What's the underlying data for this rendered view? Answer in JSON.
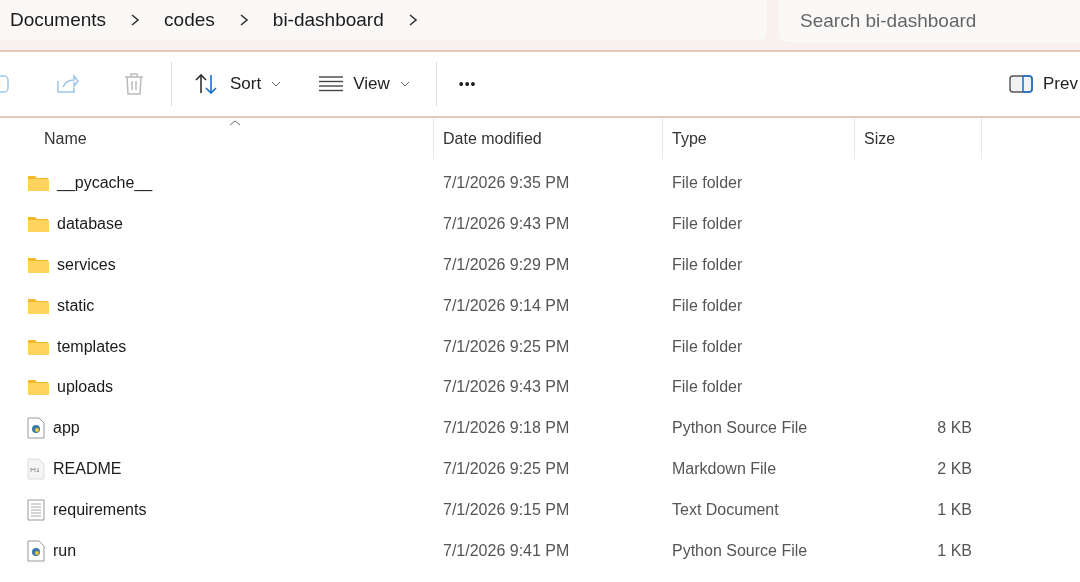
{
  "breadcrumb": [
    "Documents",
    "codes",
    "bi-dashboard"
  ],
  "search": {
    "placeholder": "Search bi-dashboard"
  },
  "toolbar": {
    "sort": "Sort",
    "view": "View",
    "more": "•••",
    "preview": "Prev"
  },
  "columns": [
    {
      "label": "Name",
      "sorted": true
    },
    {
      "label": "Date modified",
      "sorted": false
    },
    {
      "label": "Type",
      "sorted": false
    },
    {
      "label": "Size",
      "sorted": false
    }
  ],
  "rows": [
    {
      "kind": "folder",
      "name": "__pycache__",
      "date": "7/1/2026 9:35 PM",
      "type": "File folder"
    },
    {
      "kind": "folder",
      "name": "database",
      "date": "7/1/2026 9:43 PM",
      "type": "File folder"
    },
    {
      "kind": "folder",
      "name": "services",
      "date": "7/1/2026 9:29 PM",
      "type": "File folder"
    },
    {
      "kind": "folder",
      "name": "static",
      "date": "7/1/2026 9:14 PM",
      "type": "File folder"
    },
    {
      "kind": "folder",
      "name": "templates",
      "date": "7/1/2026 9:25 PM",
      "type": "File folder"
    },
    {
      "kind": "folder",
      "name": "uploads",
      "date": "7/1/2026 9:43 PM",
      "type": "File folder"
    },
    {
      "kind": "python",
      "name": "app",
      "date": "7/1/2026 9:18 PM",
      "type": "Python Source File",
      "size": "8 KB"
    },
    {
      "kind": "markdown",
      "name": "README",
      "date": "7/1/2026 9:25 PM",
      "type": "Markdown File",
      "size": "2 KB"
    },
    {
      "kind": "text",
      "name": "requirements",
      "date": "7/1/2026 9:15 PM",
      "type": "Text Document",
      "size": "1 KB"
    },
    {
      "kind": "python",
      "name": "run",
      "date": "7/1/2026 9:41 PM",
      "type": "Python Source File",
      "size": "1 KB"
    }
  ]
}
